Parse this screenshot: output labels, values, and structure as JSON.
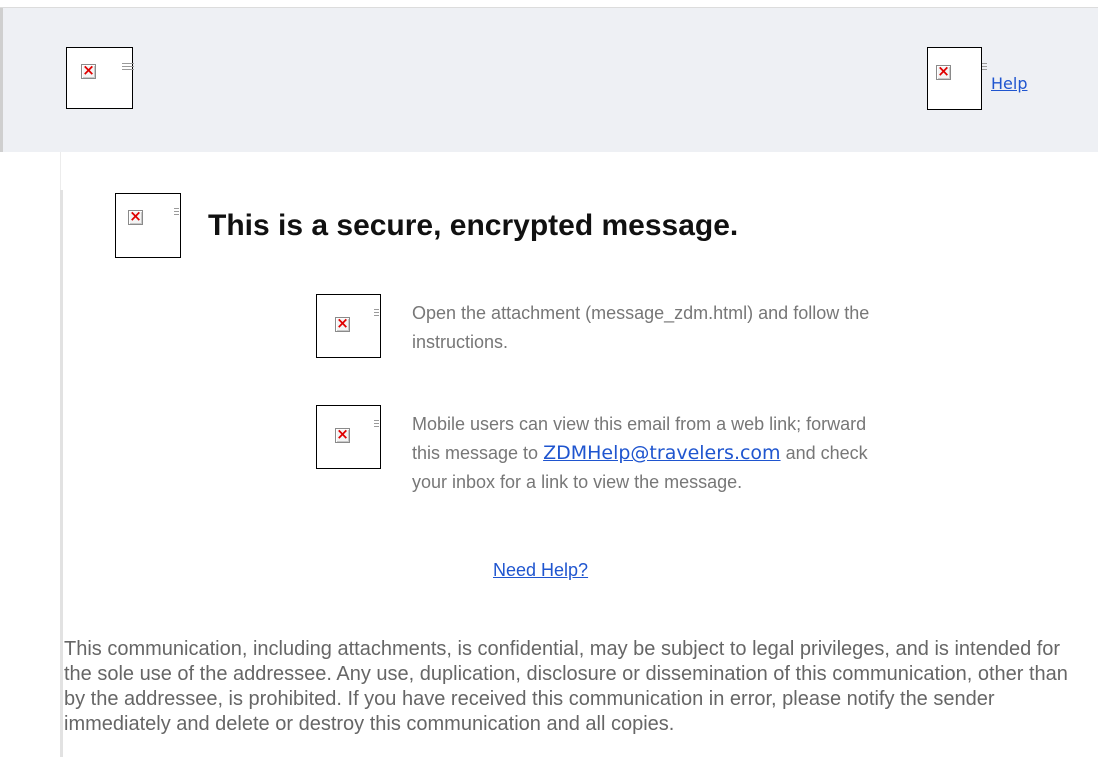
{
  "header": {
    "logo_left_icon": "broken-image-icon",
    "logo_right_icon": "broken-image-icon",
    "help_link": "Help"
  },
  "main": {
    "heading_icon": "broken-image-icon",
    "heading": "This is a secure, encrypted message.",
    "steps": [
      {
        "icon": "broken-image-icon",
        "line1": "Open the attachment (message_zdm.html) and follow the",
        "line2": "instructions."
      },
      {
        "icon": "broken-image-icon",
        "line1": "Mobile users can view this email from a web link; forward",
        "line2_before": "this message to",
        "email": "ZDMHelp@travelers.com",
        "line2_after": "and check",
        "line3": "your inbox for a link to view the message."
      }
    ],
    "need_help_link": "Need Help?",
    "disclaimer": "This communication, including attachments, is confidential, may be subject to legal privileges, and is intended for the sole use of the addressee. Any use, duplication, disclosure or dissemination of this communication, other than by the addressee, is prohibited. If you have received this communication in error, please notify the sender immediately and delete or destroy this communication and all copies."
  },
  "colors": {
    "header_bg": "#eef0f4",
    "link": "#1f55cf",
    "body_text": "#777777",
    "heading": "#111111"
  }
}
